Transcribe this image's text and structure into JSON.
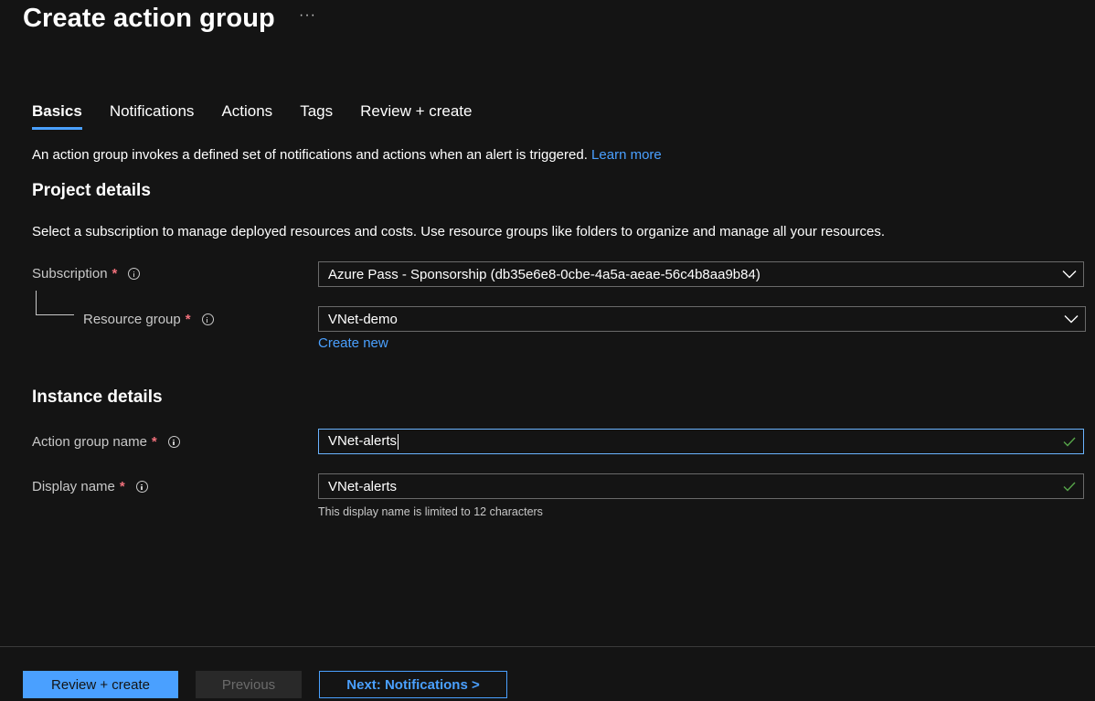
{
  "page": {
    "title": "Create action group",
    "more_label": "···"
  },
  "tabs": [
    {
      "label": "Basics",
      "active": true
    },
    {
      "label": "Notifications",
      "active": false
    },
    {
      "label": "Actions",
      "active": false
    },
    {
      "label": "Tags",
      "active": false
    },
    {
      "label": "Review + create",
      "active": false
    }
  ],
  "intro": {
    "text": "An action group invokes a defined set of notifications and actions when an alert is triggered.",
    "link": "Learn more"
  },
  "project_details": {
    "heading": "Project details",
    "description": "Select a subscription to manage deployed resources and costs. Use resource groups like folders to organize and manage all your resources.",
    "subscription": {
      "label": "Subscription",
      "required_mark": "*",
      "value": "Azure Pass - Sponsorship (db35e6e8-0cbe-4a5a-aeae-56c4b8aa9b84)",
      "icon": "chevron-down-icon"
    },
    "resource_group": {
      "label": "Resource group",
      "required_mark": "*",
      "value": "VNet-demo",
      "icon": "chevron-down-icon",
      "create_new": "Create new"
    }
  },
  "instance_details": {
    "heading": "Instance details",
    "action_group_name": {
      "label": "Action group name",
      "required_mark": "*",
      "value": "VNet-alerts",
      "valid": true
    },
    "display_name": {
      "label": "Display name",
      "required_mark": "*",
      "value": "VNet-alerts",
      "valid": true,
      "hint": "This display name is limited to 12 characters"
    }
  },
  "footer": {
    "review_create": "Review + create",
    "previous": "Previous",
    "next": "Next: Notifications >"
  },
  "colors": {
    "background": "#141414",
    "accent": "#4aa0ff",
    "required": "#f1707b",
    "valid": "#57a64a"
  }
}
